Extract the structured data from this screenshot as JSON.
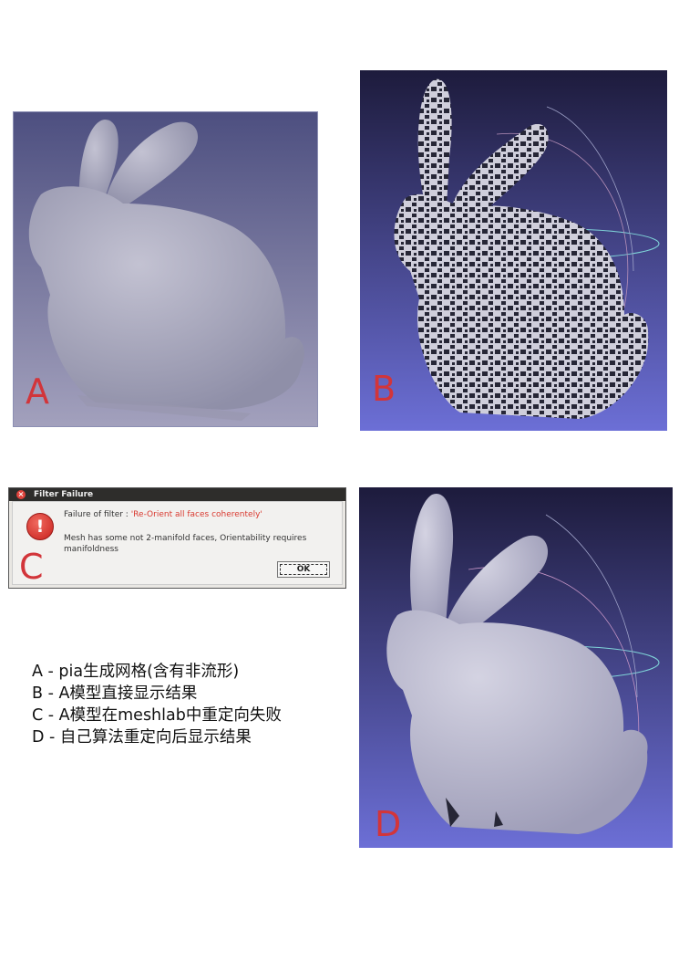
{
  "panels": {
    "a": {
      "letter": "A"
    },
    "b": {
      "letter": "B"
    },
    "c": {
      "letter": "C"
    },
    "d": {
      "letter": "D"
    }
  },
  "dialog": {
    "title": "Filter Failure",
    "failure_prefix": "Failure of filter : ",
    "filter_name": "'Re-Orient all faces coherentely'",
    "message": "Mesh has some not 2-manifold faces, Orientability requires manifoldness",
    "ok_label": "OK"
  },
  "legend": [
    "A -  pia生成网格(含有非流形)",
    "B -  A模型直接显示结果",
    "C -  A模型在meshlab中重定向失败",
    "D - 自己算法重定向后显示结果"
  ],
  "colors": {
    "letter": "#d2353a",
    "panel_a_bg_top": "#4d4f80",
    "panel_a_bg_bottom": "#9c9ab8",
    "meshlab_bg_top": "#1c1a3a",
    "meshlab_bg_bottom": "#6f71d6",
    "bunny": "#c7c6d6"
  }
}
